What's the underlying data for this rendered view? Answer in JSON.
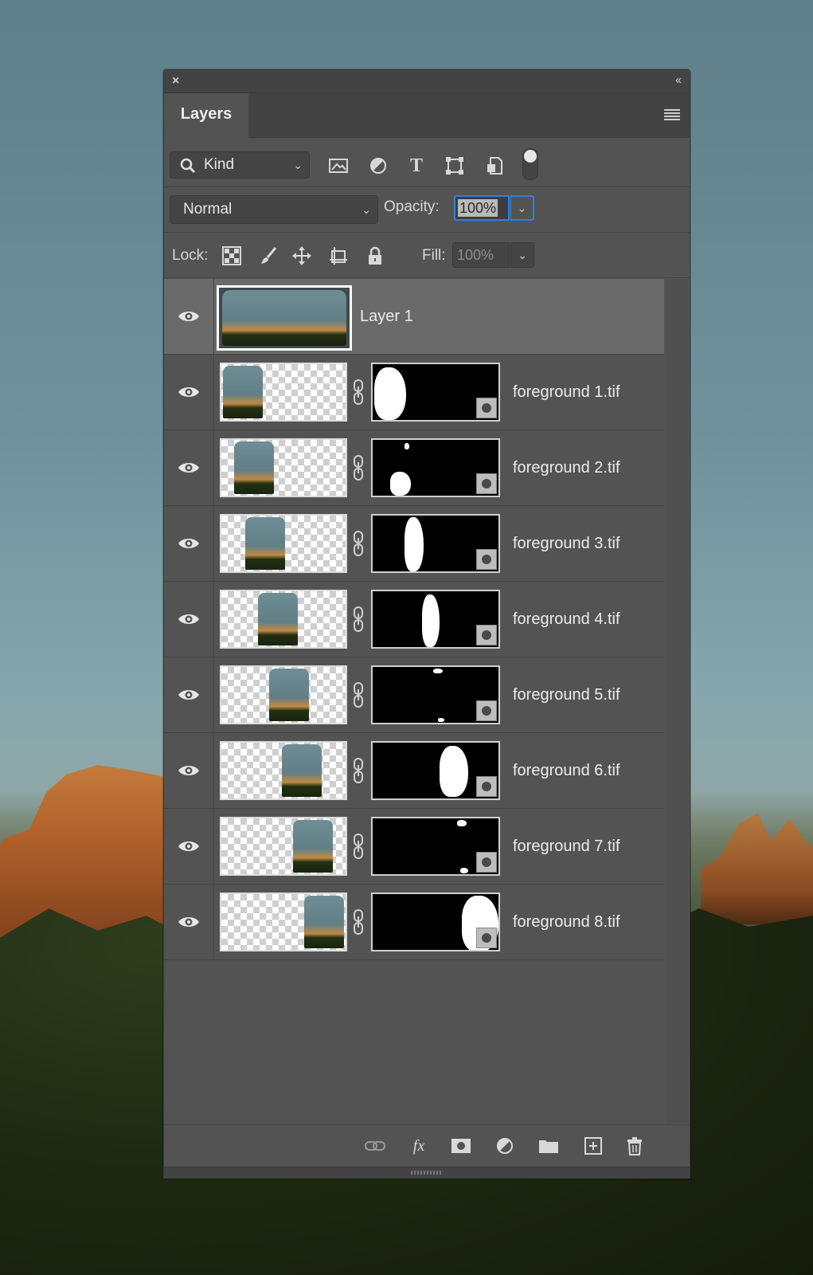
{
  "panel": {
    "tab_label": "Layers",
    "filter": {
      "kind_label": "Kind"
    },
    "blend_mode": "Normal",
    "opacity_label": "Opacity:",
    "opacity_value": "100%",
    "lock_label": "Lock:",
    "fill_label": "Fill:",
    "fill_value": "100%"
  },
  "layers": [
    {
      "name": "Layer 1",
      "selected": true,
      "visible": true,
      "has_mask": false
    },
    {
      "name": "foreground 1.tif",
      "visible": true,
      "has_mask": true
    },
    {
      "name": "foreground 2.tif",
      "visible": true,
      "has_mask": true
    },
    {
      "name": "foreground 3.tif",
      "visible": true,
      "has_mask": true
    },
    {
      "name": "foreground 4.tif",
      "visible": true,
      "has_mask": true
    },
    {
      "name": "foreground 5.tif",
      "visible": true,
      "has_mask": true
    },
    {
      "name": "foreground 6.tif",
      "visible": true,
      "has_mask": true
    },
    {
      "name": "foreground 7.tif",
      "visible": true,
      "has_mask": true
    },
    {
      "name": "foreground 8.tif",
      "visible": true,
      "has_mask": true
    }
  ],
  "icons": {
    "filter": [
      "image-filter-icon",
      "adjustment-filter-icon",
      "type-filter-icon",
      "shape-filter-icon",
      "smart-object-filter-icon"
    ],
    "lock": [
      "lock-transparent-pixels-icon",
      "lock-image-pixels-icon",
      "lock-position-icon",
      "lock-artboard-icon",
      "lock-all-icon"
    ],
    "footer": [
      "link-layers-icon",
      "fx-icon",
      "add-mask-icon",
      "adjustment-layer-icon",
      "new-group-icon",
      "new-layer-icon",
      "delete-layer-icon"
    ]
  },
  "colors": {
    "panel_bg": "#535353",
    "selected_row": "#6a6a6a",
    "focus_ring": "#2f7fe3",
    "text": "#ececec"
  }
}
